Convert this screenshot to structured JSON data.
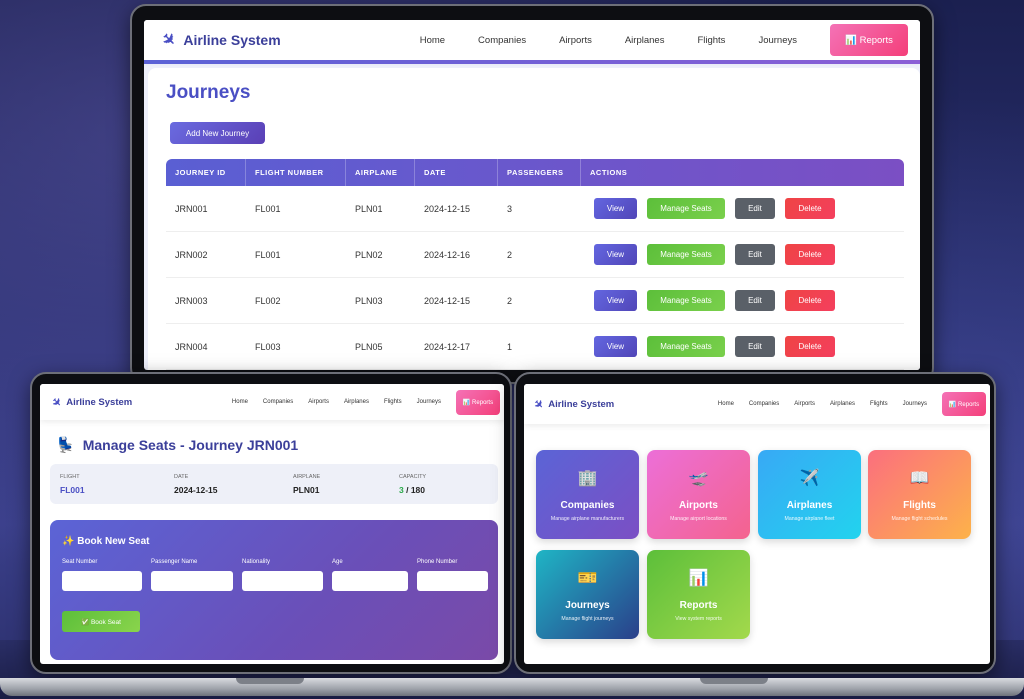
{
  "main": {
    "brand": "Airline System",
    "nav": [
      "Home",
      "Companies",
      "Airports",
      "Airplanes",
      "Flights",
      "Journeys"
    ],
    "reports_label": "📊 Reports",
    "page_title": "Journeys",
    "add_button": "Add New Journey",
    "columns": [
      "JOURNEY ID",
      "FLIGHT NUMBER",
      "AIRPLANE",
      "DATE",
      "PASSENGERS",
      "ACTIONS"
    ],
    "rows": [
      {
        "id": "JRN001",
        "flight": "FL001",
        "airplane": "PLN01",
        "date": "2024-12-15",
        "passengers": "3"
      },
      {
        "id": "JRN002",
        "flight": "FL001",
        "airplane": "PLN02",
        "date": "2024-12-16",
        "passengers": "2"
      },
      {
        "id": "JRN003",
        "flight": "FL002",
        "airplane": "PLN03",
        "date": "2024-12-15",
        "passengers": "2"
      },
      {
        "id": "JRN004",
        "flight": "FL003",
        "airplane": "PLN05",
        "date": "2024-12-17",
        "passengers": "1"
      }
    ],
    "actions": {
      "view": "View",
      "manage": "Manage Seats",
      "edit": "Edit",
      "delete": "Delete"
    }
  },
  "seats": {
    "brand": "Airline System",
    "nav": [
      "Home",
      "Companies",
      "Airports",
      "Airplanes",
      "Flights",
      "Journeys"
    ],
    "reports_label": "📊 Reports",
    "title": "Manage Seats - Journey JRN001",
    "info": {
      "flight_label": "FLIGHT",
      "flight": "FL001",
      "date_label": "DATE",
      "date": "2024-12-15",
      "airplane_label": "AIRPLANE",
      "airplane": "PLN01",
      "capacity_label": "CAPACITY",
      "capacity_used": "3",
      "capacity_total": "/ 180"
    },
    "form_title": "✨ Book New Seat",
    "fields": [
      "Seat Number",
      "Passenger Name",
      "Nationality",
      "Age",
      "Phone Number"
    ],
    "book_button": "✅ Book Seat"
  },
  "dashboard": {
    "brand": "Airline System",
    "nav": [
      "Home",
      "Companies",
      "Airports",
      "Airplanes",
      "Flights",
      "Journeys"
    ],
    "reports_label": "📊 Reports",
    "tiles": [
      {
        "icon": "🏢",
        "title": "Companies",
        "desc": "Manage airplane manufacturers",
        "color": "#5b64d6"
      },
      {
        "icon": "🛫",
        "title": "Airports",
        "desc": "Manage airport locations",
        "color": "#f472b6"
      },
      {
        "icon": "✈️",
        "title": "Airplanes",
        "desc": "Manage airplane fleet",
        "color": "#22c1ee"
      },
      {
        "icon": "📖",
        "title": "Flights",
        "desc": "Manage flight schedules",
        "color": "#fb8f5a"
      },
      {
        "icon": "🎫",
        "title": "Journeys",
        "desc": "Manage flight journeys",
        "color": "#1aa0b8"
      },
      {
        "icon": "📊",
        "title": "Reports",
        "desc": "View system reports",
        "color": "#6cc344"
      }
    ]
  }
}
